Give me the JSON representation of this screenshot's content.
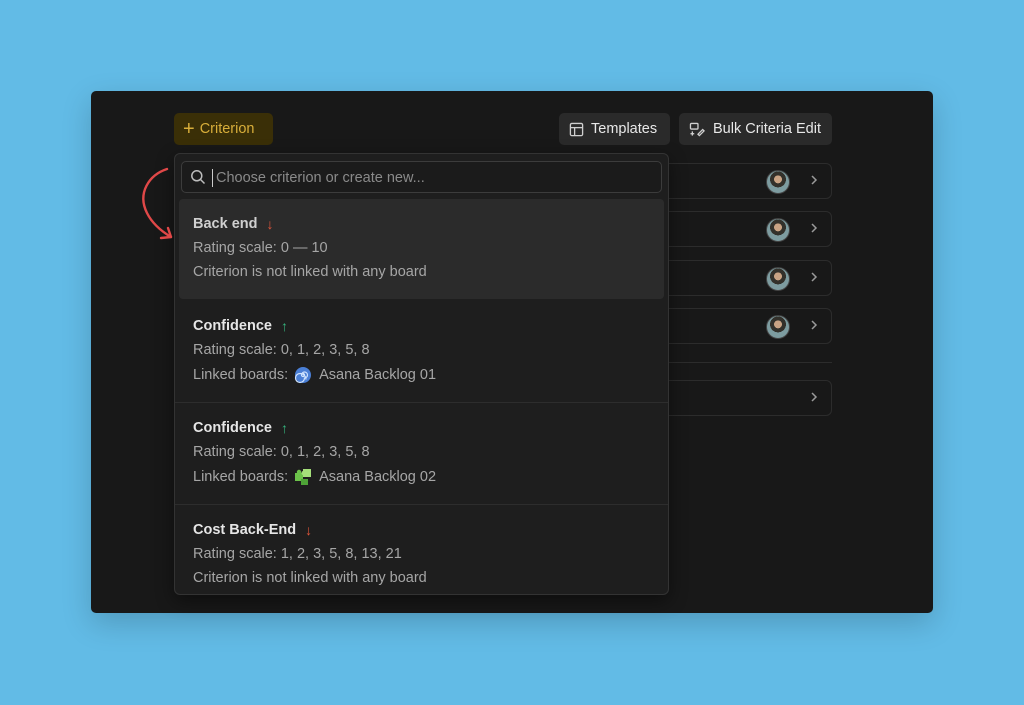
{
  "toolbar": {
    "criterion_label": "Criterion",
    "templates_label": "Templates",
    "bulk_label": "Bulk Criteria Edit"
  },
  "search": {
    "placeholder": "Choose criterion or create new..."
  },
  "items": [
    {
      "title": "Back end",
      "direction": "down",
      "arrow": "↓",
      "scale": "Rating scale: 0 — 10",
      "link": "Criterion is not linked with any board"
    },
    {
      "title": "Confidence",
      "direction": "up",
      "arrow": "↑",
      "scale": "Rating scale: 0, 1, 2, 3, 5, 8",
      "link_prefix": "Linked boards:",
      "board_icon": "spiral-icon",
      "board": "Asana Backlog 01"
    },
    {
      "title": "Confidence",
      "direction": "up",
      "arrow": "↑",
      "scale": "Rating scale: 0, 1, 2, 3, 5, 8",
      "link_prefix": "Linked boards:",
      "board_icon": "puzzle-icon",
      "board": "Asana Backlog 02"
    },
    {
      "title": "Cost Back-End",
      "direction": "down",
      "arrow": "↓",
      "scale": "Rating scale: 1, 2, 3, 5, 8, 13, 21",
      "link": "Criterion is not linked with any board"
    }
  ],
  "colors": {
    "background": "#62bbe6",
    "panel": "#181818",
    "accent": "#d8ae3a",
    "arrow_down": "#e0553a",
    "arrow_up": "#36b37e",
    "annotation": "#e04848"
  }
}
